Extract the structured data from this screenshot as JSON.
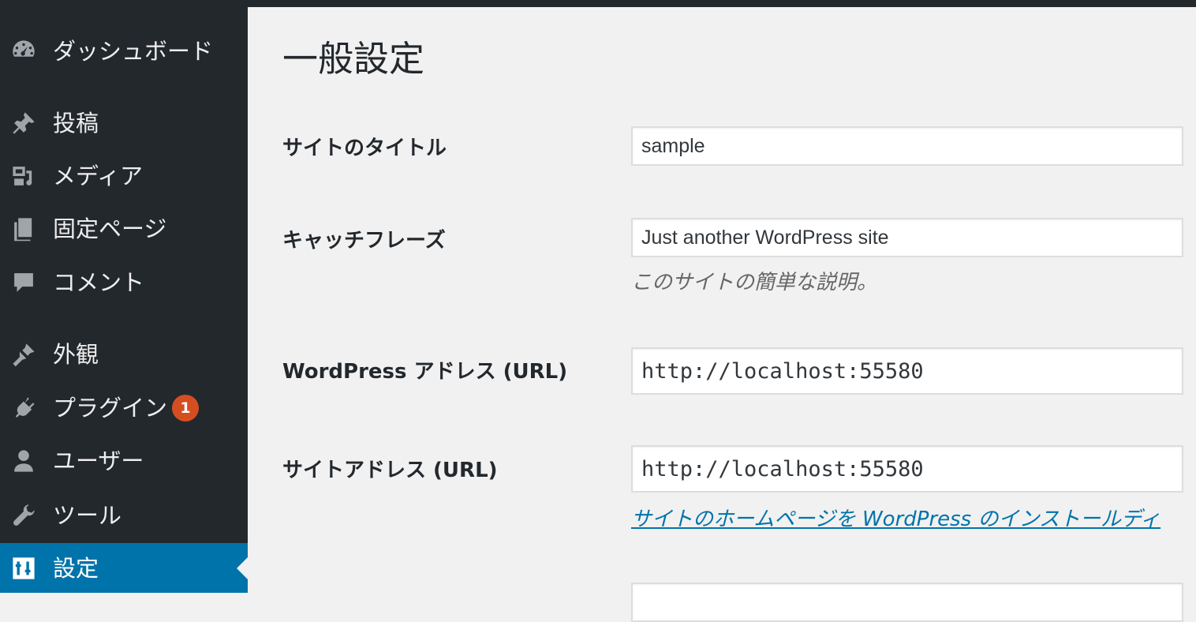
{
  "sidebar": {
    "items": [
      {
        "label": "ダッシュボード",
        "icon": "dashboard-icon"
      },
      {
        "label": "投稿",
        "icon": "pin-icon"
      },
      {
        "label": "メディア",
        "icon": "media-icon"
      },
      {
        "label": "固定ページ",
        "icon": "pages-icon"
      },
      {
        "label": "コメント",
        "icon": "comment-icon"
      },
      {
        "label": "外観",
        "icon": "paintbrush-icon"
      },
      {
        "label": "プラグイン",
        "icon": "plugin-icon",
        "badge": "1"
      },
      {
        "label": "ユーザー",
        "icon": "user-icon"
      },
      {
        "label": "ツール",
        "icon": "wrench-icon"
      },
      {
        "label": "設定",
        "icon": "settings-icon",
        "current": true
      }
    ]
  },
  "main": {
    "title": "一般設定",
    "fields": {
      "site_title": {
        "label": "サイトのタイトル",
        "value": "sample"
      },
      "tagline": {
        "label": "キャッチフレーズ",
        "value": "Just another WordPress site",
        "description": "このサイトの簡単な説明。"
      },
      "wp_address": {
        "label": "WordPress アドレス (URL)",
        "value": "http://localhost:55580"
      },
      "site_address": {
        "label": "サイトアドレス (URL)",
        "value": "http://localhost:55580",
        "link": "サイトのホームページを WordPress のインストールディ"
      }
    }
  },
  "colors": {
    "sidebar_bg": "#23282d",
    "accent": "#0073aa",
    "badge": "#d54e21",
    "page_bg": "#f1f1f1"
  }
}
